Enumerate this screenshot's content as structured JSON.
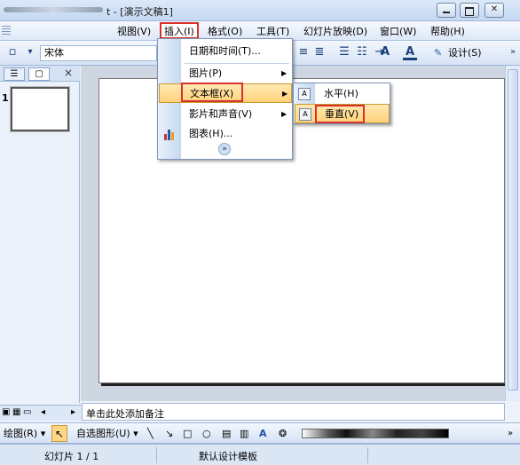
{
  "window": {
    "title": "t - [演示文稿1]"
  },
  "menubar": {
    "items": [
      "视图(V)",
      "插入(I)",
      "格式(O)",
      "工具(T)",
      "幻灯片放映(D)",
      "窗口(W)",
      "帮助(H)"
    ],
    "active_index": 1
  },
  "toolbar": {
    "font_name": "宋体",
    "design_label": "设计(S)",
    "icons": [
      "new-icon",
      "align-center-icon",
      "align-right-icon",
      "numbering-icon",
      "bullets-icon",
      "indent-icon",
      "increase-font-icon",
      "font-color-icon"
    ]
  },
  "insert_menu": {
    "items": [
      {
        "label": "日期和时间(T)...",
        "icon": "calendar-icon",
        "has_submenu": false
      },
      {
        "label": "图片(P)",
        "icon": "",
        "has_submenu": true
      },
      {
        "label": "文本框(X)",
        "icon": "",
        "has_submenu": true
      },
      {
        "label": "影片和声音(V)",
        "icon": "",
        "has_submenu": true
      },
      {
        "label": "图表(H)...",
        "icon": "chart-icon",
        "has_submenu": false
      }
    ],
    "hovered_index": 2,
    "expand_icon": "expand-arrows-icon"
  },
  "textbox_submenu": {
    "items": [
      {
        "label": "水平(H)",
        "icon": "horizontal-textbox-icon"
      },
      {
        "label": "垂直(V)",
        "icon": "vertical-textbox-icon"
      }
    ],
    "hovered_index": 1
  },
  "left_panel": {
    "slide_number": "1",
    "close_glyph": "×"
  },
  "notes": {
    "placeholder": "单击此处添加备注"
  },
  "drawing_toolbar": {
    "draw_label": "绘图(R)",
    "autoshapes_label": "自选图形(U)"
  },
  "status": {
    "slide_info": "幻灯片 1 / 1",
    "template": "默认设计模板"
  },
  "colors": {
    "highlight_red": "#d8322c",
    "hover_orange": "#ffd27a"
  }
}
